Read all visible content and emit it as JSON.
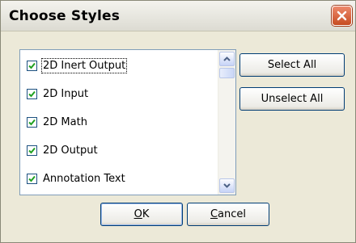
{
  "dialog": {
    "title": "Choose Styles",
    "close_icon": "close-x-icon"
  },
  "styles_list": {
    "items": [
      {
        "label": "2D Inert Output",
        "checked": true,
        "focused": true
      },
      {
        "label": "2D Input",
        "checked": true
      },
      {
        "label": "2D Math",
        "checked": true
      },
      {
        "label": "2D Output",
        "checked": true
      },
      {
        "label": "Annotation Text",
        "checked": true
      }
    ],
    "scrollbar": {
      "up_icon": "scroll-up-arrow-icon",
      "down_icon": "scroll-down-arrow-icon"
    }
  },
  "buttons": {
    "select_all": "Select All",
    "unselect_all": "Unselect All",
    "ok": {
      "mnemonic": "O",
      "rest": "K"
    },
    "cancel": {
      "mnemonic": "C",
      "rest": "ancel"
    }
  },
  "colors": {
    "window_bg": "#ece9d8",
    "close_button": "#d05a32",
    "checkmark": "#21a121",
    "list_border": "#7f9db9"
  }
}
